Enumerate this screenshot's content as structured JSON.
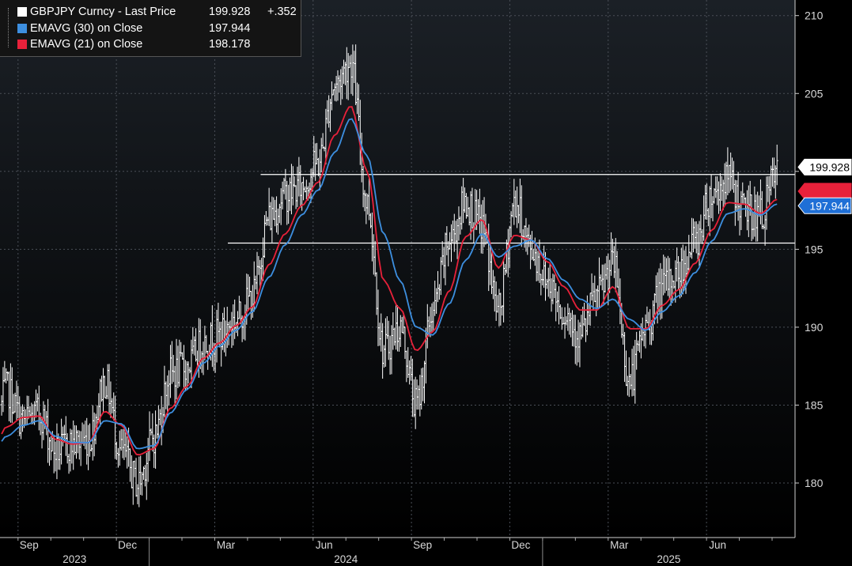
{
  "legend": {
    "main_name": "GBPJPY Curncy - Last Price",
    "main_value": "199.928",
    "main_change": "+.352",
    "ema30_name": "EMAVG (30)  on Close",
    "ema30_value": "197.944",
    "ema21_name": "EMAVG (21)  on Close",
    "ema21_value": "198.178"
  },
  "colors": {
    "background": "#000000",
    "plot_gradient_top": "#1b2026",
    "price": "#ffffff",
    "ema30": "#3d8fe0",
    "ema21": "#e8213a",
    "grid": "#4a4f57",
    "tag_blue": "#1f6fd6"
  },
  "chart_data": {
    "type": "line",
    "title": "",
    "ylim": [
      176.5,
      211
    ],
    "y_ticks": [
      180,
      185,
      190,
      195,
      200,
      205,
      210
    ],
    "y_tick_labels": [
      "180",
      "185",
      "190",
      "195",
      "",
      "205",
      "210"
    ],
    "month_ticks": [
      "Sep",
      "Dec",
      "Mar",
      "Jun",
      "Sep",
      "Dec",
      "Mar",
      "Jun"
    ],
    "year_labels": [
      "2023",
      "2024",
      "2025"
    ],
    "x_start": "2023-08",
    "x_end": "2025-08",
    "price_last": 199.928,
    "ema30_last": 197.944,
    "ema21_last": 198.178,
    "horizontal_lines": [
      {
        "value": 199.8,
        "from": "2024-04",
        "to": "2025-08"
      },
      {
        "value": 195.4,
        "from": "2024-03",
        "to": "2025-08"
      }
    ],
    "series": [
      {
        "name": "GBPJPY Curncy - Last Price",
        "x": [
          "2023-08",
          "2023-08",
          "2023-09",
          "2023-09",
          "2023-10",
          "2023-10",
          "2023-11",
          "2023-11",
          "2023-12",
          "2023-12",
          "2024-01",
          "2024-01",
          "2024-02",
          "2024-02",
          "2024-03",
          "2024-03",
          "2024-04",
          "2024-04",
          "2024-05",
          "2024-05",
          "2024-06",
          "2024-06",
          "2024-07",
          "2024-07",
          "2024-08",
          "2024-08",
          "2024-09",
          "2024-09",
          "2024-10",
          "2024-10",
          "2024-11",
          "2024-11",
          "2024-12",
          "2024-12",
          "2025-01",
          "2025-01",
          "2025-02",
          "2025-02",
          "2025-03",
          "2025-03",
          "2025-04",
          "2025-04",
          "2025-05",
          "2025-05",
          "2025-06",
          "2025-06",
          "2025-07",
          "2025-07",
          "2025-08"
        ],
        "values": [
          181.5,
          186.0,
          184.0,
          184.5,
          182.0,
          182.5,
          182.8,
          186.5,
          182.0,
          180.0,
          183.0,
          187.0,
          187.5,
          189.0,
          189.5,
          190.5,
          192.0,
          197.0,
          198.5,
          199.0,
          200.5,
          205.5,
          207.0,
          198.0,
          188.5,
          190.0,
          185.0,
          191.0,
          195.5,
          198.0,
          196.5,
          191.0,
          198.0,
          195.0,
          193.0,
          191.0,
          189.5,
          192.0,
          194.0,
          186.5,
          190.0,
          192.5,
          193.5,
          195.5,
          198.5,
          199.5,
          197.5,
          197.2,
          199.9
        ]
      },
      {
        "name": "EMAVG (30) on Close",
        "values": [
          181.5,
          183.0,
          183.7,
          184.0,
          183.0,
          182.6,
          182.6,
          184.0,
          183.8,
          182.2,
          182.4,
          184.5,
          186.0,
          187.7,
          188.8,
          189.8,
          191.0,
          193.2,
          195.3,
          197.2,
          198.8,
          201.2,
          203.4,
          201.0,
          196.0,
          193.0,
          190.0,
          189.5,
          191.5,
          194.3,
          196.0,
          194.5,
          195.2,
          195.6,
          194.4,
          193.0,
          191.8,
          191.2,
          191.8,
          190.5,
          189.8,
          191.0,
          192.0,
          193.5,
          195.5,
          197.3,
          197.6,
          197.2,
          197.9
        ]
      },
      {
        "name": "EMAVG (21) on Close",
        "values": [
          181.5,
          183.6,
          184.2,
          184.3,
          182.8,
          182.5,
          182.6,
          184.6,
          183.7,
          181.8,
          182.2,
          184.8,
          186.2,
          188.0,
          189.0,
          190.1,
          191.3,
          194.0,
          196.0,
          197.8,
          199.3,
          202.3,
          204.2,
          200.0,
          193.0,
          191.2,
          188.5,
          189.7,
          192.3,
          195.8,
          196.9,
          193.8,
          195.9,
          195.6,
          194.2,
          192.6,
          191.1,
          191.1,
          192.6,
          189.9,
          189.9,
          191.4,
          192.4,
          194.1,
          196.2,
          198.0,
          197.9,
          197.3,
          198.2
        ]
      }
    ]
  }
}
